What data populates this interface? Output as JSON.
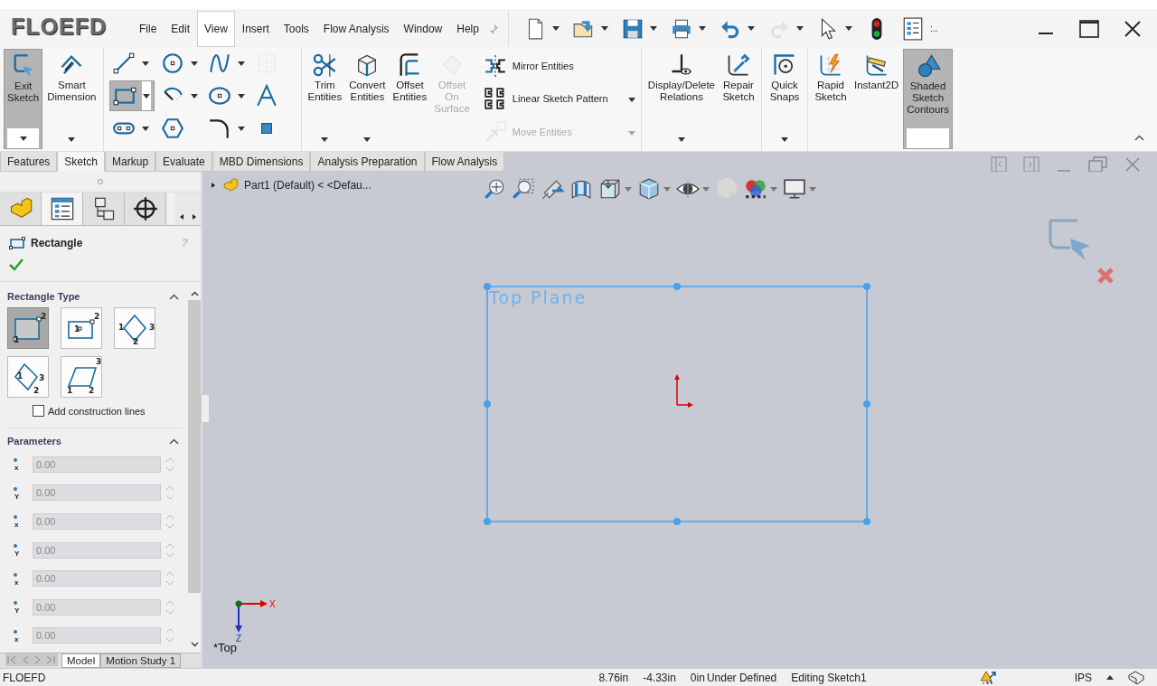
{
  "app_name": "FLOEFD",
  "menu": [
    {
      "label": "File",
      "selected": false
    },
    {
      "label": "Edit",
      "selected": false
    },
    {
      "label": "View",
      "selected": true
    },
    {
      "label": "Insert",
      "selected": false
    },
    {
      "label": "Tools",
      "selected": false
    },
    {
      "label": "Flow Analysis",
      "selected": false
    },
    {
      "label": "Window",
      "selected": false
    },
    {
      "label": "Help",
      "selected": false
    }
  ],
  "quick_access": [
    {
      "disabled": false,
      "dropdown": true
    },
    {
      "disabled": false,
      "dropdown": true
    },
    {
      "disabled": false,
      "dropdown": true
    },
    {
      "disabled": false,
      "dropdown": true
    },
    {
      "disabled": false,
      "dropdown": true
    },
    {
      "disabled": true,
      "dropdown": true
    },
    {
      "disabled": false,
      "dropdown": true
    },
    {
      "disabled": false,
      "dropdown": false
    },
    {
      "disabled": false,
      "dropdown": false
    }
  ],
  "quick_access_more": ":..",
  "ribbon_groups": [
    {
      "kind": "buttons",
      "tools": [
        {
          "label": "Exit\nSketch",
          "selected": true,
          "disabled": false,
          "dropdown": true
        },
        {
          "label": "Smart\nDimension",
          "selected": false,
          "disabled": false,
          "dropdown": true
        }
      ]
    },
    {
      "kind": "grid",
      "tools": [
        {
          "selected": false,
          "disabled": false,
          "dropdown": true
        },
        {
          "selected": false,
          "disabled": false,
          "dropdown": true
        },
        {
          "selected": false,
          "disabled": false,
          "dropdown": true
        },
        {
          "selected": false,
          "disabled": true,
          "dropdown": false
        },
        {
          "selected": true,
          "disabled": false,
          "dropdown": true
        },
        {
          "selected": false,
          "disabled": false,
          "dropdown": true
        },
        {
          "selected": false,
          "disabled": false,
          "dropdown": true
        },
        {
          "selected": false,
          "disabled": false,
          "dropdown": false
        },
        {
          "selected": false,
          "disabled": false,
          "dropdown": true
        },
        {
          "selected": false,
          "disabled": false,
          "dropdown": false
        },
        {
          "selected": false,
          "disabled": false,
          "dropdown": true
        },
        {
          "selected": false,
          "disabled": false,
          "dropdown": false
        }
      ]
    },
    {
      "kind": "buttons",
      "tools": [
        {
          "label": "Trim\nEntities",
          "selected": false,
          "disabled": false,
          "dropdown": true
        },
        {
          "label": "Convert\nEntities",
          "selected": false,
          "disabled": false,
          "dropdown": true
        },
        {
          "label": "Offset\nEntities",
          "selected": false,
          "disabled": false,
          "dropdown": false
        },
        {
          "label": "Offset\nOn\nSurface",
          "selected": false,
          "disabled": true,
          "dropdown": false
        }
      ]
    },
    {
      "kind": "stack",
      "tools": [
        {
          "label": "Mirror Entities",
          "selected": false,
          "disabled": false,
          "dropdown": false
        },
        {
          "label": "Linear Sketch Pattern",
          "selected": false,
          "disabled": false,
          "dropdown": true
        },
        {
          "label": "Move Entities",
          "selected": false,
          "disabled": true,
          "dropdown": true
        }
      ]
    },
    {
      "kind": "buttons",
      "tools": [
        {
          "label": "Display/Delete\nRelations",
          "selected": false,
          "disabled": false,
          "dropdown": true
        },
        {
          "label": "Repair\nSketch",
          "selected": false,
          "disabled": false,
          "dropdown": false
        }
      ]
    },
    {
      "kind": "buttons",
      "tools": [
        {
          "label": "Quick\nSnaps",
          "selected": false,
          "disabled": false,
          "dropdown": true
        }
      ]
    },
    {
      "kind": "buttons",
      "tools": [
        {
          "label": "Rapid\nSketch",
          "selected": false,
          "disabled": false,
          "dropdown": false
        },
        {
          "label": "Instant2D",
          "selected": false,
          "disabled": false,
          "dropdown": false
        },
        {
          "label": "Shaded\nSketch\nContours",
          "selected": true,
          "disabled": false,
          "dropdown": false
        }
      ]
    }
  ],
  "command_tabs": [
    {
      "label": "Features",
      "selected": false
    },
    {
      "label": "Sketch",
      "selected": true
    },
    {
      "label": "Markup",
      "selected": false
    },
    {
      "label": "Evaluate",
      "selected": false
    },
    {
      "label": "MBD Dimensions",
      "selected": false
    },
    {
      "label": "Analysis Preparation",
      "selected": false
    },
    {
      "label": "Flow Analysis",
      "selected": false
    }
  ],
  "panel_tabs": [
    {
      "selected": false
    },
    {
      "selected": true
    },
    {
      "selected": false
    },
    {
      "selected": false
    }
  ],
  "property_manager": {
    "title": "Rectangle",
    "help": "?"
  },
  "rectangle_type_title": "Rectangle Type",
  "rectangle_types": [
    {
      "selected": true,
      "labels": [
        "1",
        "2"
      ]
    },
    {
      "selected": false,
      "labels": [
        "1",
        "2"
      ]
    },
    {
      "selected": false,
      "labels": [
        "1",
        "3",
        "2"
      ]
    },
    {
      "selected": false,
      "labels": [
        "1",
        "3",
        "2"
      ]
    },
    {
      "selected": false,
      "labels": [
        "3",
        "1",
        "2"
      ]
    }
  ],
  "construction_lines": {
    "label": "Add construction lines",
    "checked": false
  },
  "parameters_title": "Parameters",
  "parameters": [
    {
      "axis": "x",
      "value": "0.00"
    },
    {
      "axis": "Y",
      "value": "0.00"
    },
    {
      "axis": "x",
      "value": "0.00"
    },
    {
      "axis": "Y",
      "value": "0.00"
    },
    {
      "axis": "x",
      "value": "0.00"
    },
    {
      "axis": "Y",
      "value": "0.00"
    },
    {
      "axis": "x",
      "value": "0.00"
    }
  ],
  "tree_item": "Part1 (Default) < <Defau...",
  "viewport": {
    "plane_label": "Top Plane",
    "view_label": "*Top",
    "triad": [
      "X",
      "Z"
    ]
  },
  "bottom_tabs": [
    {
      "label": "Model",
      "selected": true
    },
    {
      "label": "Motion Study 1",
      "selected": false
    }
  ],
  "status_bar": {
    "app": "FLOEFD",
    "x": "8.76in",
    "y": "-4.33in",
    "z": "0in",
    "state": "Under Defined",
    "mode": "Editing Sketch1",
    "units": "IPS"
  }
}
